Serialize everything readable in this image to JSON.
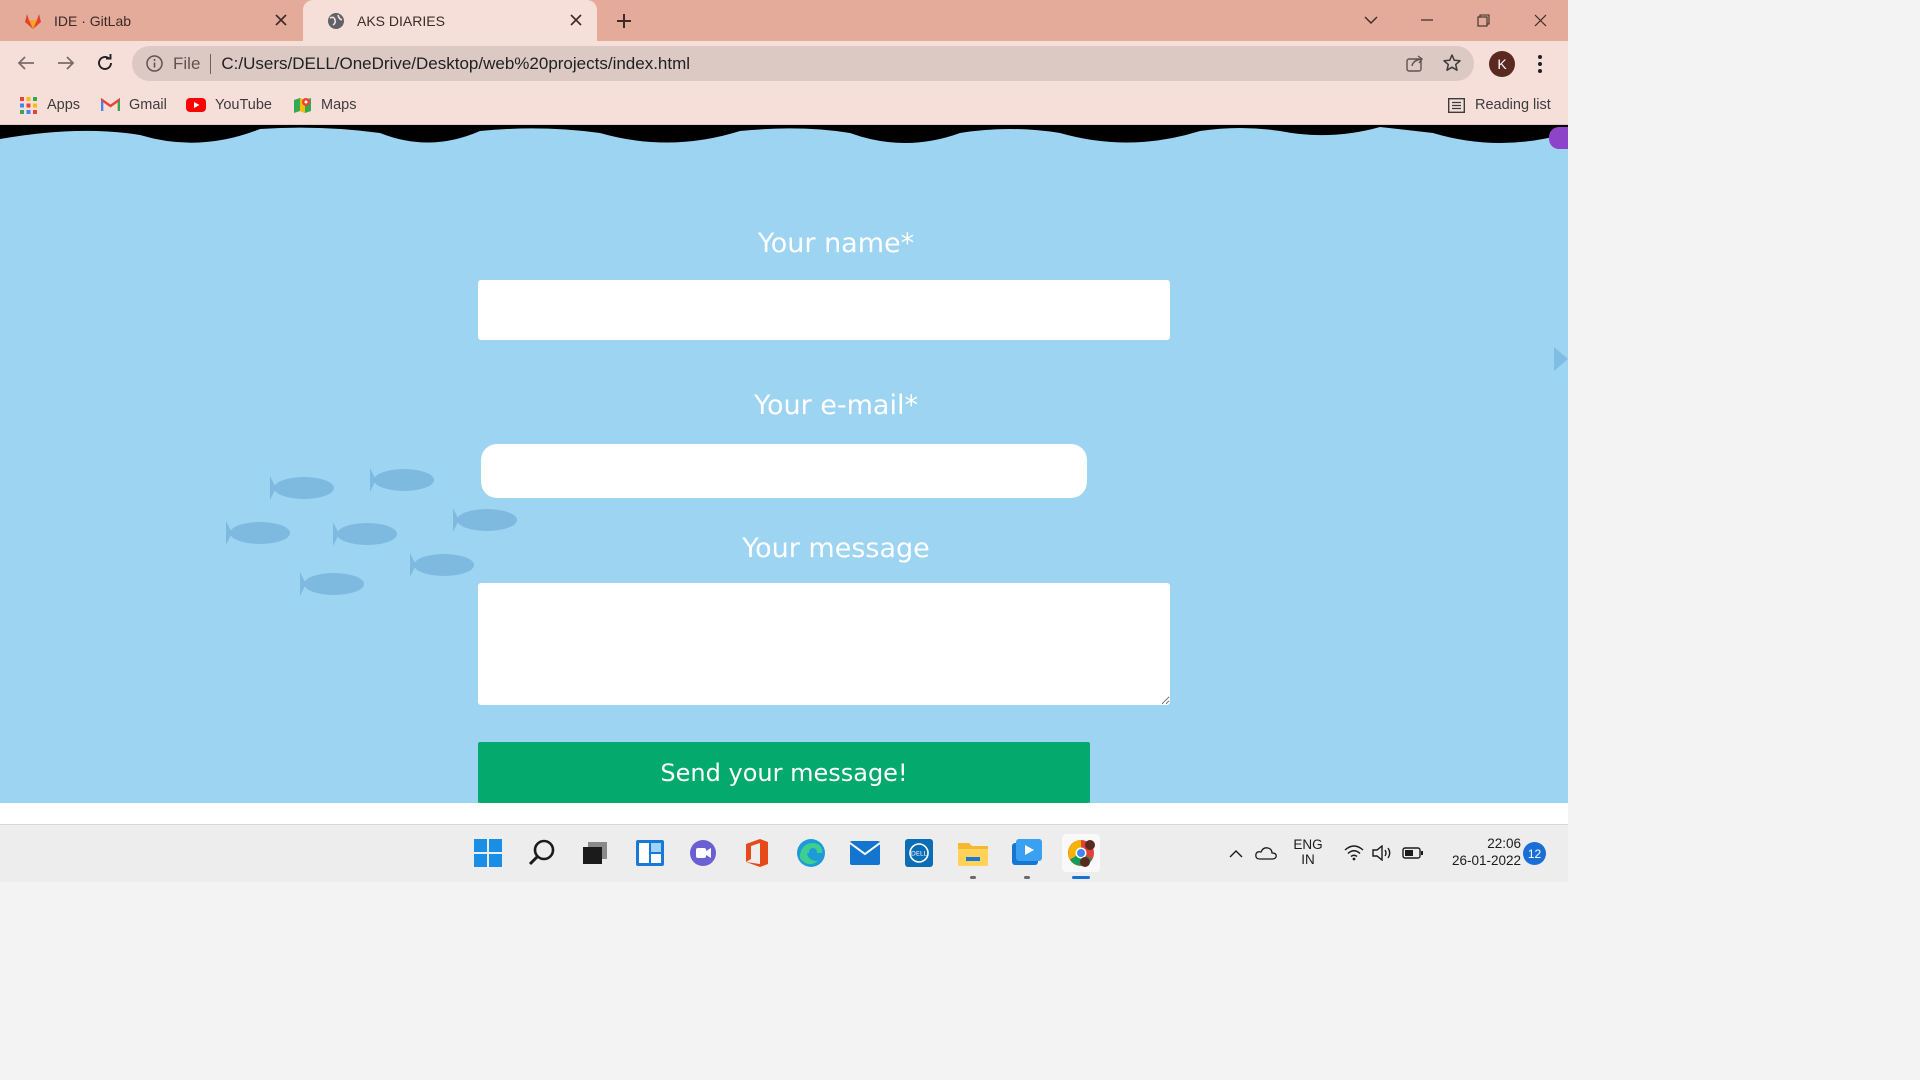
{
  "browser": {
    "tabs": [
      {
        "title": "IDE · GitLab",
        "icon": "gitlab-icon"
      },
      {
        "title": "AKS DIARIES",
        "icon": "globe-icon",
        "active": true
      }
    ],
    "address": {
      "scheme_label": "File",
      "url": "C:/Users/DELL/OneDrive/Desktop/web%20projects/index.html"
    },
    "profile_initial": "K",
    "bookmarks": [
      {
        "label": "Apps",
        "icon": "apps-grid-icon"
      },
      {
        "label": "Gmail",
        "icon": "gmail-icon"
      },
      {
        "label": "YouTube",
        "icon": "youtube-icon"
      },
      {
        "label": "Maps",
        "icon": "maps-icon"
      }
    ],
    "reading_list_label": "Reading list"
  },
  "page": {
    "background_color": "#9dd4f2",
    "form": {
      "name_label": "Your name*",
      "email_label": "Your e-mail*",
      "message_label": "Your message",
      "name_value": "",
      "email_value": "",
      "message_value": "",
      "submit_label": "Send your message!"
    },
    "colors": {
      "submit": "#04a96d",
      "label": "#ffffff"
    }
  },
  "taskbar": {
    "apps": [
      "windows-start-icon",
      "search-icon",
      "task-view-icon",
      "widgets-icon",
      "teams-chat-icon",
      "office-icon",
      "edge-icon",
      "mail-icon",
      "dell-icon",
      "file-explorer-icon",
      "media-player-icon",
      "chrome-icon"
    ],
    "language_line1": "ENG",
    "language_line2": "IN",
    "time": "22:06",
    "date": "26-01-2022",
    "notification_count": "12"
  }
}
